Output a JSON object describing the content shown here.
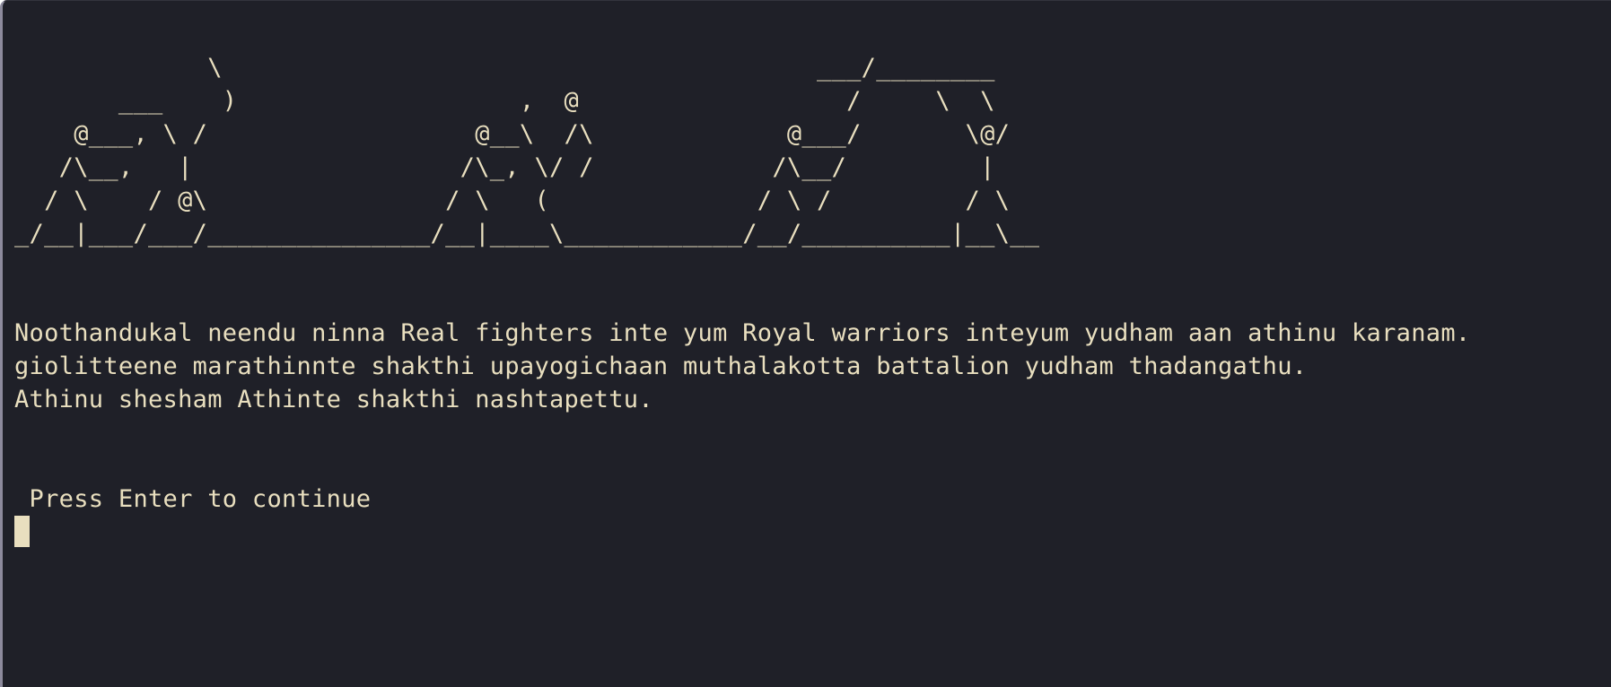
{
  "colors": {
    "background": "#1f2028",
    "foreground": "#e9dfbf",
    "window_border": "#8c8a9c"
  },
  "terminal": {
    "ascii_art": [
      "             \\                                        ___/________",
      "       ___    )                   ,  @                  /     \\  \\",
      "    @___, \\ /                  @__\\  /\\             @___/       \\@/",
      "   /\\__,   |                  /\\_, \\/ /            /\\__/         |",
      "  / \\    / @\\                / \\   (              / \\ /         / \\",
      "_/__|___/___/_______________/__|____\\____________/__/__________|__\\__"
    ],
    "story_lines": [
      "Noothandukal neendu ninna Real fighters inte yum Royal warriors inteyum yudham aan athinu karanam.",
      "giolitteene marathinnte shakthi upayogichaan muthalakotta battalion yudham thadangathu.",
      "Athinu shesham Athinte shakthi nashtapettu."
    ],
    "prompt": " Press Enter to continue"
  }
}
